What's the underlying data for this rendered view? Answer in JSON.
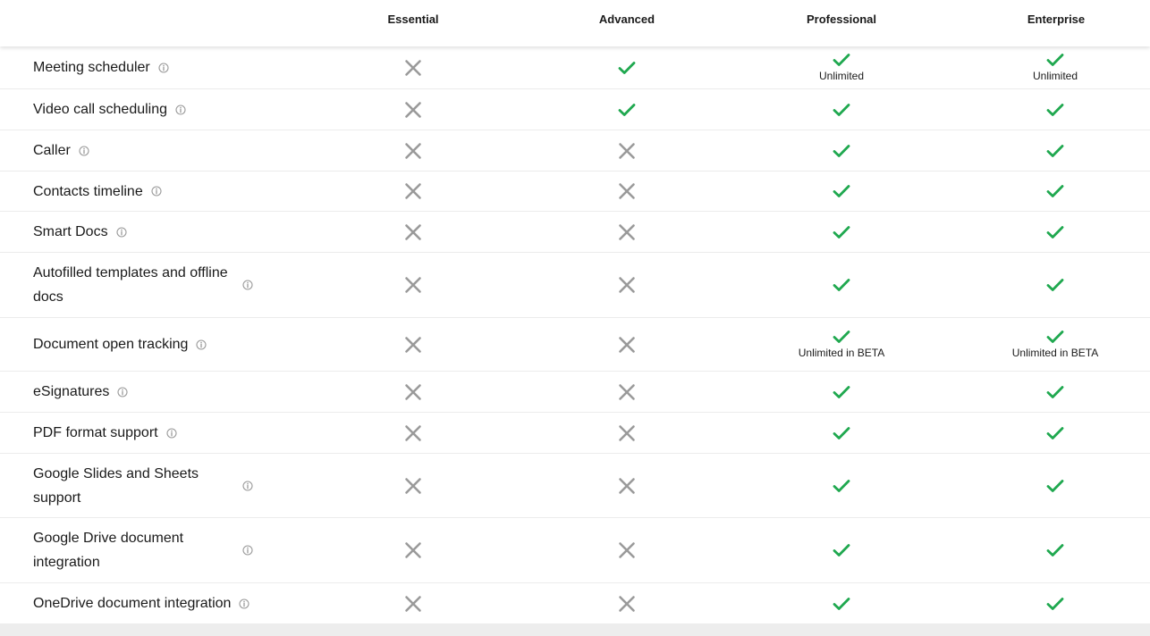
{
  "plans": [
    "Essential",
    "Advanced",
    "Professional",
    "Enterprise"
  ],
  "colors": {
    "check": "#1fa84f",
    "cross": "#9a9a9a",
    "info": "#9a9a9a"
  },
  "icons": {
    "available": "check-icon",
    "unavailable": "close-icon",
    "info": "info-icon"
  },
  "features": [
    {
      "label": "Meeting scheduler",
      "cells": [
        {
          "status": false,
          "note": ""
        },
        {
          "status": true,
          "note": ""
        },
        {
          "status": true,
          "note": "Unlimited"
        },
        {
          "status": true,
          "note": "Unlimited"
        }
      ]
    },
    {
      "label": "Video call scheduling",
      "cells": [
        {
          "status": false,
          "note": ""
        },
        {
          "status": true,
          "note": ""
        },
        {
          "status": true,
          "note": ""
        },
        {
          "status": true,
          "note": ""
        }
      ]
    },
    {
      "label": "Caller",
      "cells": [
        {
          "status": false,
          "note": ""
        },
        {
          "status": false,
          "note": ""
        },
        {
          "status": true,
          "note": ""
        },
        {
          "status": true,
          "note": ""
        }
      ]
    },
    {
      "label": "Contacts timeline",
      "cells": [
        {
          "status": false,
          "note": ""
        },
        {
          "status": false,
          "note": ""
        },
        {
          "status": true,
          "note": ""
        },
        {
          "status": true,
          "note": ""
        }
      ]
    },
    {
      "label": "Smart Docs",
      "cells": [
        {
          "status": false,
          "note": ""
        },
        {
          "status": false,
          "note": ""
        },
        {
          "status": true,
          "note": ""
        },
        {
          "status": true,
          "note": ""
        }
      ]
    },
    {
      "label": "Autofilled templates and offline docs",
      "cells": [
        {
          "status": false,
          "note": ""
        },
        {
          "status": false,
          "note": ""
        },
        {
          "status": true,
          "note": ""
        },
        {
          "status": true,
          "note": ""
        }
      ]
    },
    {
      "label": "Document open tracking",
      "cells": [
        {
          "status": false,
          "note": ""
        },
        {
          "status": false,
          "note": ""
        },
        {
          "status": true,
          "note": "Unlimited in BETA"
        },
        {
          "status": true,
          "note": "Unlimited in BETA"
        }
      ]
    },
    {
      "label": "eSignatures",
      "cells": [
        {
          "status": false,
          "note": ""
        },
        {
          "status": false,
          "note": ""
        },
        {
          "status": true,
          "note": ""
        },
        {
          "status": true,
          "note": ""
        }
      ]
    },
    {
      "label": "PDF format support",
      "cells": [
        {
          "status": false,
          "note": ""
        },
        {
          "status": false,
          "note": ""
        },
        {
          "status": true,
          "note": ""
        },
        {
          "status": true,
          "note": ""
        }
      ]
    },
    {
      "label": "Google Slides and Sheets support",
      "cells": [
        {
          "status": false,
          "note": ""
        },
        {
          "status": false,
          "note": ""
        },
        {
          "status": true,
          "note": ""
        },
        {
          "status": true,
          "note": ""
        }
      ]
    },
    {
      "label": "Google Drive document integration",
      "cells": [
        {
          "status": false,
          "note": ""
        },
        {
          "status": false,
          "note": ""
        },
        {
          "status": true,
          "note": ""
        },
        {
          "status": true,
          "note": ""
        }
      ]
    },
    {
      "label": "OneDrive document integration",
      "cells": [
        {
          "status": false,
          "note": ""
        },
        {
          "status": false,
          "note": ""
        },
        {
          "status": true,
          "note": ""
        },
        {
          "status": true,
          "note": ""
        }
      ]
    }
  ]
}
